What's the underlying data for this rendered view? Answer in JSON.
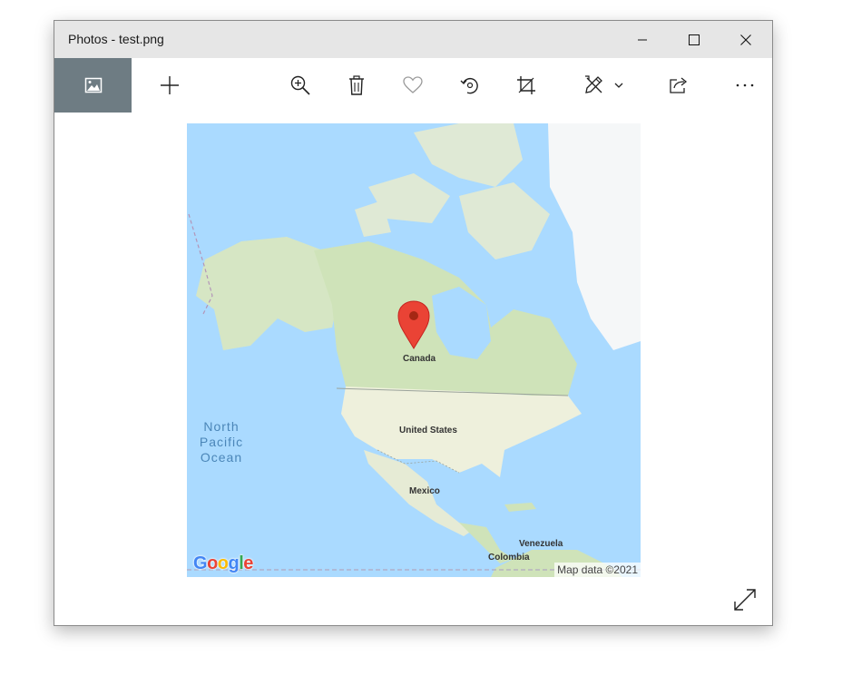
{
  "window": {
    "title": "Photos - test.png"
  },
  "titlebar_buttons": [
    "minimize-icon",
    "maximize-icon",
    "close-icon"
  ],
  "toolbar": {
    "items": [
      "view-image-icon",
      "add-icon",
      "zoom-in-icon",
      "delete-icon",
      "heart-icon",
      "rotate-icon",
      "crop-icon",
      "edit-draw-icon",
      "chevron-down-icon",
      "share-icon",
      "more-icon"
    ],
    "accent": "#6e7c83"
  },
  "map": {
    "labels": {
      "canada": "Canada",
      "united_states": "United States",
      "mexico": "Mexico",
      "venezuela": "Venezuela",
      "colombia": "Colombia"
    },
    "ocean": [
      "North",
      "Pacific",
      "Ocean"
    ],
    "attribution": "Map data ©2021",
    "logo": [
      "G",
      "o",
      "o",
      "g",
      "l",
      "e"
    ],
    "marker_color": "#ea4335"
  },
  "footer": {
    "fullscreen_icon": "expand-icon"
  }
}
